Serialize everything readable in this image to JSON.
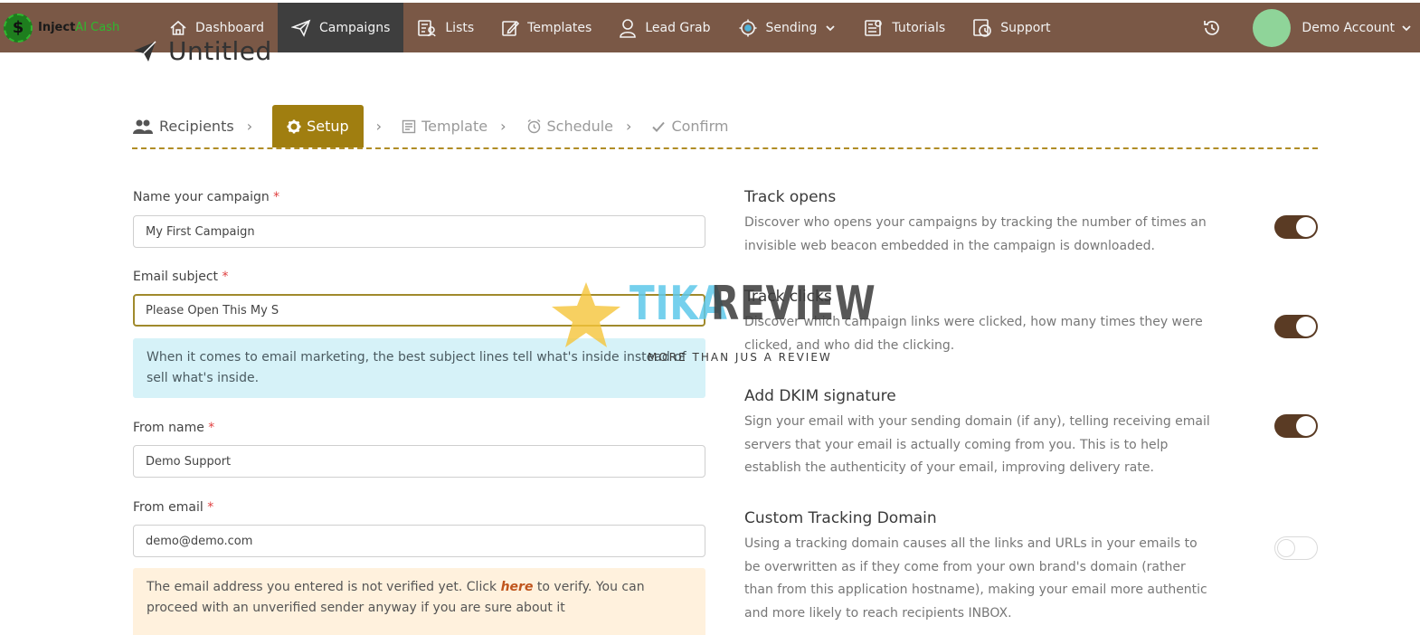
{
  "brand": {
    "logo_glyph": "$",
    "name_part1": "Inject",
    "name_part2": "AI Cash"
  },
  "nav": {
    "items": [
      {
        "label": "Dashboard",
        "icon": "home-icon"
      },
      {
        "label": "Campaigns",
        "icon": "paper-plane-icon",
        "active": true
      },
      {
        "label": "Lists",
        "icon": "list-icon"
      },
      {
        "label": "Templates",
        "icon": "edit-icon"
      },
      {
        "label": "Lead Grab",
        "icon": "user-icon"
      },
      {
        "label": "Sending",
        "icon": "gear-icon"
      },
      {
        "label": "Tutorials",
        "icon": "tutorials-icon"
      },
      {
        "label": "Support",
        "icon": "support-icon"
      }
    ],
    "account_name": "Demo Account"
  },
  "page": {
    "title": "Untitled"
  },
  "wizard": {
    "steps": [
      {
        "label": "Recipients",
        "icon": "users-icon"
      },
      {
        "label": "Setup",
        "icon": "gear-icon",
        "active": true
      },
      {
        "label": "Template",
        "icon": "template-icon"
      },
      {
        "label": "Schedule",
        "icon": "alarm-clock-icon"
      },
      {
        "label": "Confirm",
        "icon": "check-icon"
      }
    ],
    "separator": "›"
  },
  "form": {
    "campaign_name": {
      "label": "Name your campaign",
      "value": "My First Campaign"
    },
    "email_subject": {
      "label": "Email subject",
      "value": "Please Open This My S"
    },
    "subject_tip": "When it comes to email marketing, the best subject lines tell what's inside instead of sell what's inside.",
    "from_name": {
      "label": "From name",
      "value": "Demo Support"
    },
    "from_email": {
      "label": "From email",
      "value": "demo@demo.com"
    },
    "verify_notice": {
      "before": "The email address you entered is not verified yet. Click",
      "link": "here",
      "after": "to verify. You can proceed with an unverified sender anyway if you are sure about it"
    },
    "required_mark": "*"
  },
  "settings": [
    {
      "title": "Track opens",
      "description": "Discover who opens your campaigns by tracking the number of times an invisible web beacon embedded in the campaign is downloaded.",
      "enabled": true
    },
    {
      "title": "Track clicks",
      "description": "Discover which campaign links were clicked, how many times they were clicked, and who did the clicking.",
      "enabled": true
    },
    {
      "title": "Add DKIM signature",
      "description": "Sign your email with your sending domain (if any), telling receiving email servers that your email is actually coming from you. This is to help establish the authenticity of your email, improving delivery rate.",
      "enabled": true
    },
    {
      "title": "Custom Tracking Domain",
      "description": "Using a tracking domain causes all the links and URLs in your emails to be overwritten as if they come from your own brand's domain (rather than from this application hostname), making your email more authentic and more likely to reach recipients INBOX.",
      "enabled": false
    }
  ],
  "watermark": {
    "word1": "TIKA",
    "word2": "REVIEW",
    "tagline": "MORE THAN JUS A REVIEW"
  },
  "colors": {
    "nav_bg": "#7a5846",
    "nav_active": "#3e3e3e",
    "accent": "#a07e10",
    "toggle_on": "#5a3b24"
  }
}
